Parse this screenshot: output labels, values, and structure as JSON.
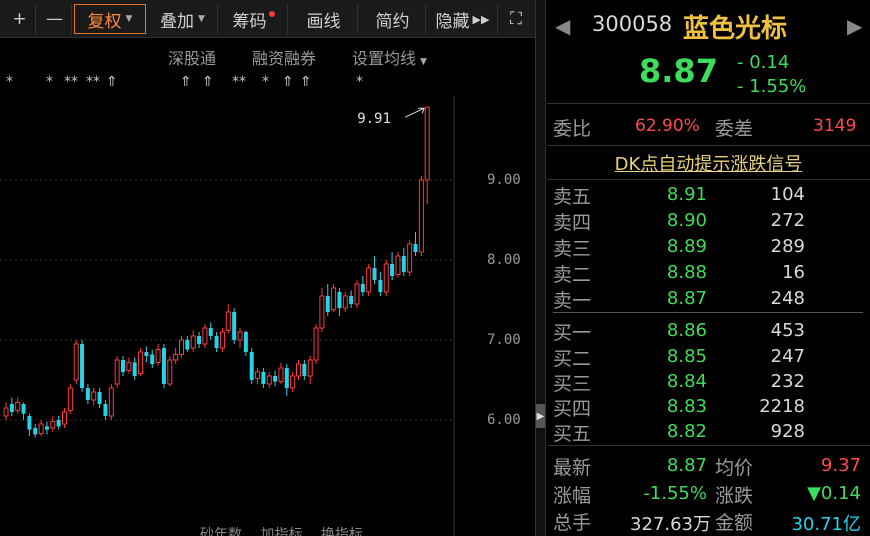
{
  "toolbar": {
    "plus": "+",
    "minus": "—",
    "fuquan": "复权",
    "diejia": "叠加",
    "chouma": "筹码",
    "huaxian": "画线",
    "jianyue": "简约",
    "yincang": "隐藏",
    "yincang_arrow": "▶▶",
    "expand": "⛶"
  },
  "sub_toolbar": {
    "shengutong": "深股通",
    "rongzi": "融资融券",
    "shezhi": "设置均线"
  },
  "flags": [
    "*",
    "*",
    "**",
    "**",
    "⇑",
    "⇑",
    "⇑",
    "**",
    "*",
    "⇑",
    "*",
    "⇑"
  ],
  "chart": {
    "high_label": "9.91",
    "axis": [
      "9.00",
      "8.00",
      "7.00",
      "6.00"
    ],
    "up_color": "#ff3b3b",
    "down_color": "#23d3e6"
  },
  "bottom_tabs": [
    "砂年数",
    "加指标",
    "换指标"
  ],
  "stock": {
    "code": "300058",
    "name": "蓝色光标",
    "price": "8.87",
    "change_abs": "- 0.14",
    "change_pct": "- 1.55%",
    "nav_left": "◀",
    "nav_right": "▶"
  },
  "weibi": {
    "label1": "委比",
    "value1": "62.90%",
    "label2": "委差",
    "value2": "3149"
  },
  "dk_link": "DK点自动提示涨跌信号",
  "order_book": {
    "asks": [
      {
        "label": "卖五",
        "price": "8.91",
        "vol": "104"
      },
      {
        "label": "卖四",
        "price": "8.90",
        "vol": "272"
      },
      {
        "label": "卖三",
        "price": "8.89",
        "vol": "289"
      },
      {
        "label": "卖二",
        "price": "8.88",
        "vol": "16"
      },
      {
        "label": "卖一",
        "price": "8.87",
        "vol": "248"
      }
    ],
    "bids": [
      {
        "label": "买一",
        "price": "8.86",
        "vol": "453"
      },
      {
        "label": "买二",
        "price": "8.85",
        "vol": "247"
      },
      {
        "label": "买三",
        "price": "8.84",
        "vol": "232"
      },
      {
        "label": "买四",
        "price": "8.83",
        "vol": "2218"
      },
      {
        "label": "买五",
        "price": "8.82",
        "vol": "928"
      }
    ]
  },
  "stats": {
    "zuixin_label": "最新",
    "zuixin": "8.87",
    "junjia_label": "均价",
    "junjia": "9.37",
    "zhangfu_label": "涨幅",
    "zhangfu": "-1.55%",
    "zhangdie_label": "涨跌",
    "zhangdie": "▼0.14",
    "zongshou_label": "总手",
    "zongshou": "327.63万",
    "jine_label": "金额",
    "jine": "30.71亿"
  },
  "colors": {
    "green": "#3ddc5c",
    "red": "#ff4a4a",
    "gold": "#f0c040",
    "orange": "#ff8a3d"
  }
}
